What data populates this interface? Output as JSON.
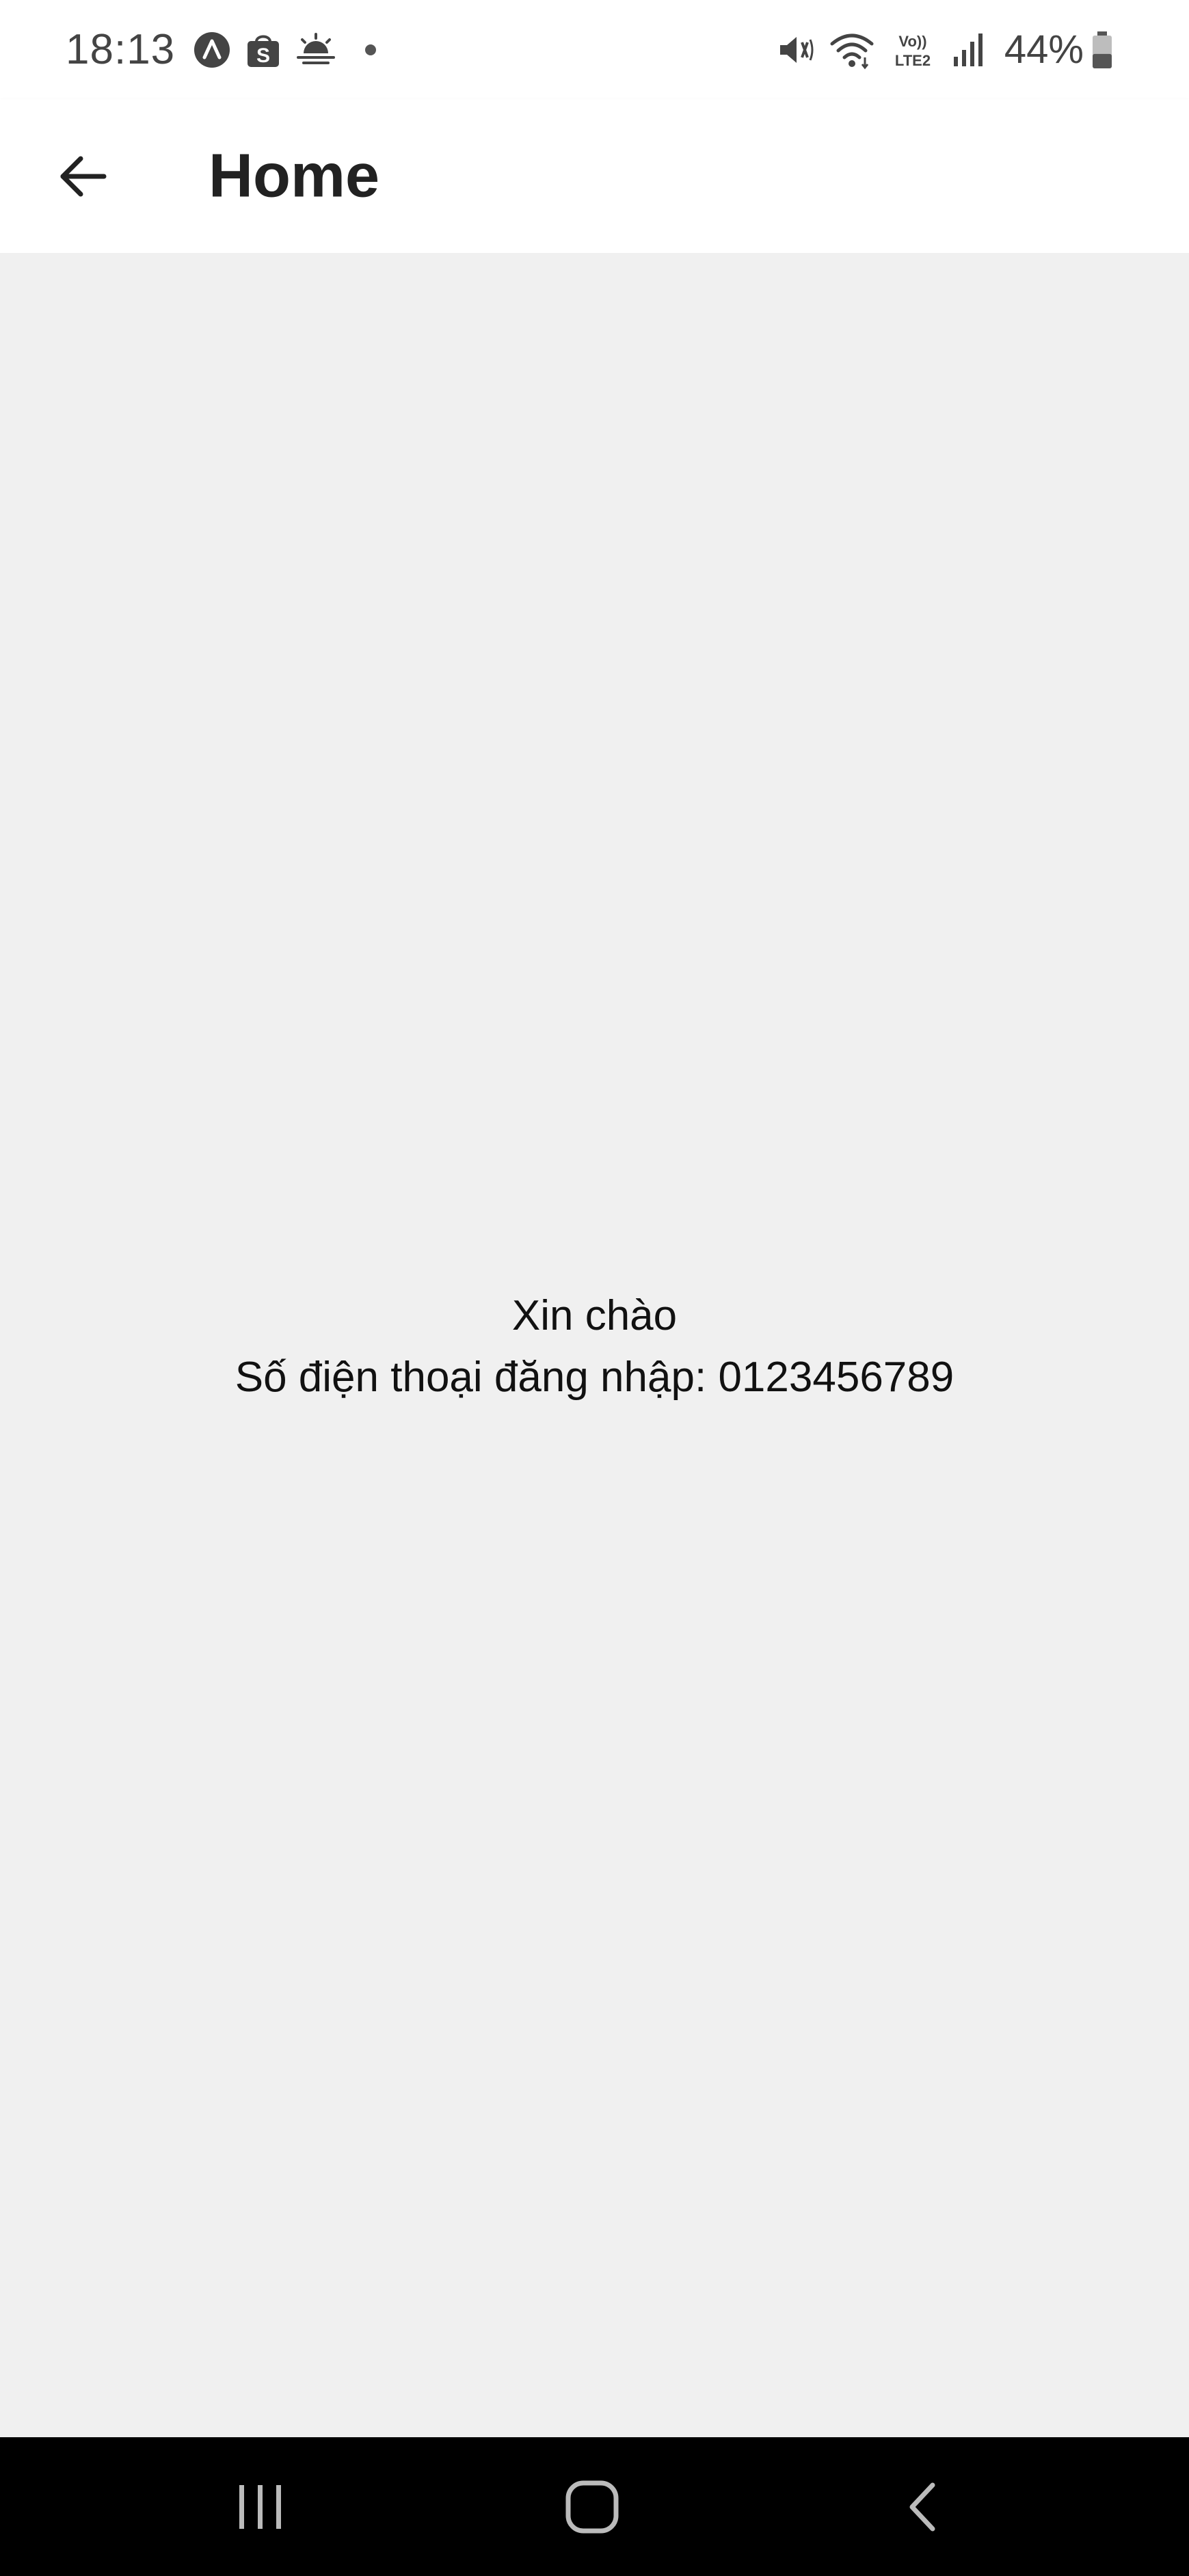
{
  "status_bar": {
    "time": "18:13",
    "notification_icons": [
      "app-a-icon",
      "shopee-bag-icon",
      "weather-sunrise-icon",
      "more-dot-icon"
    ],
    "system_icons": [
      "mute-vibrate-icon",
      "wifi-icon",
      "volte-lte2-icon",
      "signal-icon"
    ],
    "volte_label": "Vo)) LTE2",
    "battery_percent": "44%",
    "battery_level": 0.44
  },
  "app_bar": {
    "title": "Home",
    "back_icon": "arrow-left-icon"
  },
  "main": {
    "greeting": "Xin chào",
    "phone_line": "Số điện thoại đăng nhập: 0123456789"
  },
  "nav_bar": {
    "buttons": [
      "recent-apps-icon",
      "home-icon",
      "back-icon"
    ]
  },
  "colors": {
    "background": "#f0f0f0",
    "app_bar": "#ffffff",
    "nav_bar": "#000000",
    "text": "#111111"
  }
}
